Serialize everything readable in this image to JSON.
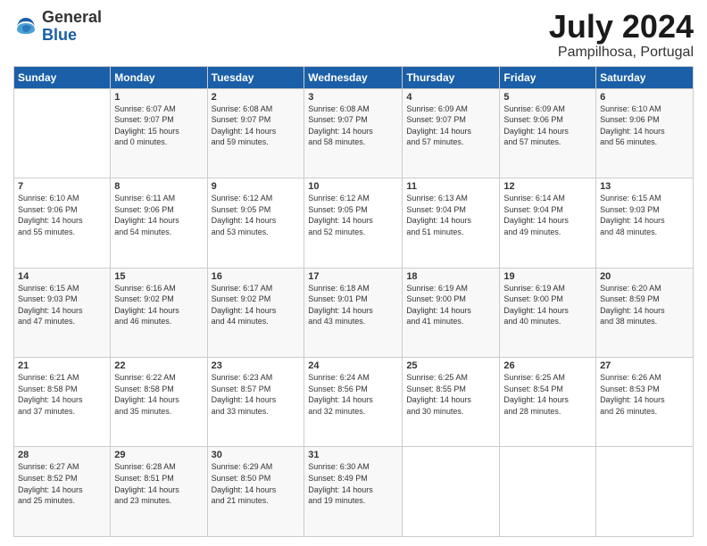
{
  "logo": {
    "general": "General",
    "blue": "Blue"
  },
  "title": {
    "month_year": "July 2024",
    "location": "Pampilhosa, Portugal"
  },
  "weekdays": [
    "Sunday",
    "Monday",
    "Tuesday",
    "Wednesday",
    "Thursday",
    "Friday",
    "Saturday"
  ],
  "weeks": [
    [
      {
        "day": "",
        "info": ""
      },
      {
        "day": "1",
        "info": "Sunrise: 6:07 AM\nSunset: 9:07 PM\nDaylight: 15 hours\nand 0 minutes."
      },
      {
        "day": "2",
        "info": "Sunrise: 6:08 AM\nSunset: 9:07 PM\nDaylight: 14 hours\nand 59 minutes."
      },
      {
        "day": "3",
        "info": "Sunrise: 6:08 AM\nSunset: 9:07 PM\nDaylight: 14 hours\nand 58 minutes."
      },
      {
        "day": "4",
        "info": "Sunrise: 6:09 AM\nSunset: 9:07 PM\nDaylight: 14 hours\nand 57 minutes."
      },
      {
        "day": "5",
        "info": "Sunrise: 6:09 AM\nSunset: 9:06 PM\nDaylight: 14 hours\nand 57 minutes."
      },
      {
        "day": "6",
        "info": "Sunrise: 6:10 AM\nSunset: 9:06 PM\nDaylight: 14 hours\nand 56 minutes."
      }
    ],
    [
      {
        "day": "7",
        "info": "Sunrise: 6:10 AM\nSunset: 9:06 PM\nDaylight: 14 hours\nand 55 minutes."
      },
      {
        "day": "8",
        "info": "Sunrise: 6:11 AM\nSunset: 9:06 PM\nDaylight: 14 hours\nand 54 minutes."
      },
      {
        "day": "9",
        "info": "Sunrise: 6:12 AM\nSunset: 9:05 PM\nDaylight: 14 hours\nand 53 minutes."
      },
      {
        "day": "10",
        "info": "Sunrise: 6:12 AM\nSunset: 9:05 PM\nDaylight: 14 hours\nand 52 minutes."
      },
      {
        "day": "11",
        "info": "Sunrise: 6:13 AM\nSunset: 9:04 PM\nDaylight: 14 hours\nand 51 minutes."
      },
      {
        "day": "12",
        "info": "Sunrise: 6:14 AM\nSunset: 9:04 PM\nDaylight: 14 hours\nand 49 minutes."
      },
      {
        "day": "13",
        "info": "Sunrise: 6:15 AM\nSunset: 9:03 PM\nDaylight: 14 hours\nand 48 minutes."
      }
    ],
    [
      {
        "day": "14",
        "info": "Sunrise: 6:15 AM\nSunset: 9:03 PM\nDaylight: 14 hours\nand 47 minutes."
      },
      {
        "day": "15",
        "info": "Sunrise: 6:16 AM\nSunset: 9:02 PM\nDaylight: 14 hours\nand 46 minutes."
      },
      {
        "day": "16",
        "info": "Sunrise: 6:17 AM\nSunset: 9:02 PM\nDaylight: 14 hours\nand 44 minutes."
      },
      {
        "day": "17",
        "info": "Sunrise: 6:18 AM\nSunset: 9:01 PM\nDaylight: 14 hours\nand 43 minutes."
      },
      {
        "day": "18",
        "info": "Sunrise: 6:19 AM\nSunset: 9:00 PM\nDaylight: 14 hours\nand 41 minutes."
      },
      {
        "day": "19",
        "info": "Sunrise: 6:19 AM\nSunset: 9:00 PM\nDaylight: 14 hours\nand 40 minutes."
      },
      {
        "day": "20",
        "info": "Sunrise: 6:20 AM\nSunset: 8:59 PM\nDaylight: 14 hours\nand 38 minutes."
      }
    ],
    [
      {
        "day": "21",
        "info": "Sunrise: 6:21 AM\nSunset: 8:58 PM\nDaylight: 14 hours\nand 37 minutes."
      },
      {
        "day": "22",
        "info": "Sunrise: 6:22 AM\nSunset: 8:58 PM\nDaylight: 14 hours\nand 35 minutes."
      },
      {
        "day": "23",
        "info": "Sunrise: 6:23 AM\nSunset: 8:57 PM\nDaylight: 14 hours\nand 33 minutes."
      },
      {
        "day": "24",
        "info": "Sunrise: 6:24 AM\nSunset: 8:56 PM\nDaylight: 14 hours\nand 32 minutes."
      },
      {
        "day": "25",
        "info": "Sunrise: 6:25 AM\nSunset: 8:55 PM\nDaylight: 14 hours\nand 30 minutes."
      },
      {
        "day": "26",
        "info": "Sunrise: 6:25 AM\nSunset: 8:54 PM\nDaylight: 14 hours\nand 28 minutes."
      },
      {
        "day": "27",
        "info": "Sunrise: 6:26 AM\nSunset: 8:53 PM\nDaylight: 14 hours\nand 26 minutes."
      }
    ],
    [
      {
        "day": "28",
        "info": "Sunrise: 6:27 AM\nSunset: 8:52 PM\nDaylight: 14 hours\nand 25 minutes."
      },
      {
        "day": "29",
        "info": "Sunrise: 6:28 AM\nSunset: 8:51 PM\nDaylight: 14 hours\nand 23 minutes."
      },
      {
        "day": "30",
        "info": "Sunrise: 6:29 AM\nSunset: 8:50 PM\nDaylight: 14 hours\nand 21 minutes."
      },
      {
        "day": "31",
        "info": "Sunrise: 6:30 AM\nSunset: 8:49 PM\nDaylight: 14 hours\nand 19 minutes."
      },
      {
        "day": "",
        "info": ""
      },
      {
        "day": "",
        "info": ""
      },
      {
        "day": "",
        "info": ""
      }
    ]
  ]
}
